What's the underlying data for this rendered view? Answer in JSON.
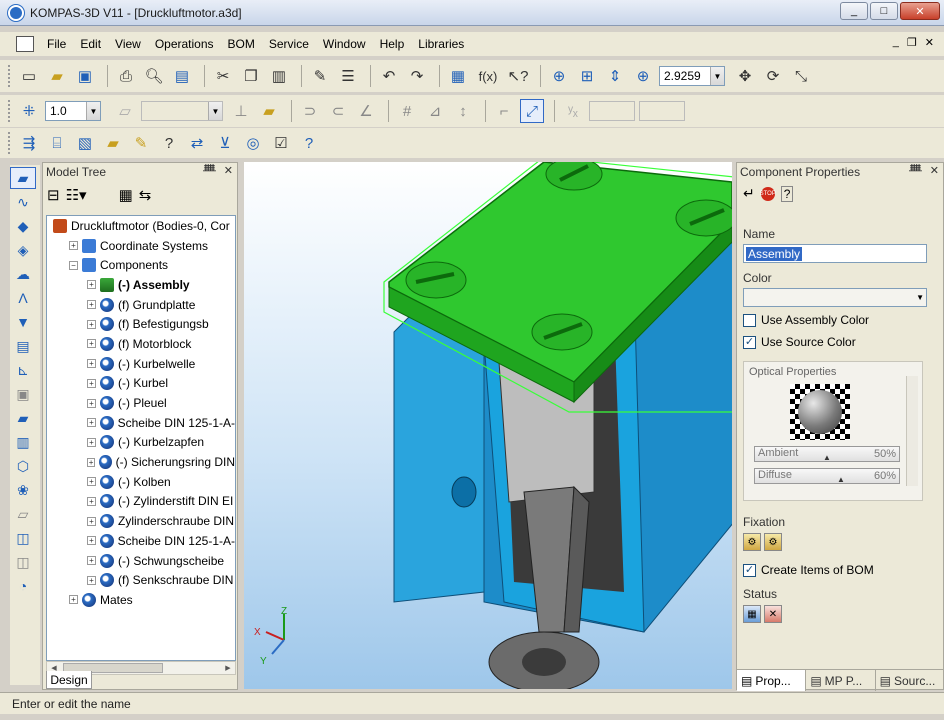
{
  "window": {
    "title": "KOMPAS-3D V11 - [Druckluftmotor.a3d]",
    "min": "_",
    "max": "□",
    "close": "✕"
  },
  "menu": {
    "items": [
      "File",
      "Edit",
      "View",
      "Operations",
      "BOM",
      "Service",
      "Window",
      "Help",
      "Libraries"
    ],
    "doc_min": "_",
    "doc_restore": "❐",
    "doc_close": "✕"
  },
  "toolbar": {
    "zoom_value": "2.9259",
    "line_scale": "1.0",
    "icons_row1": [
      "new-file-icon",
      "open-folder-icon",
      "save-icon",
      "print-icon",
      "preview-icon",
      "copy-props-icon",
      "cut-icon",
      "copy-icon",
      "paste-icon",
      "brush-icon",
      "props-icon",
      "undo-icon",
      "redo-icon",
      "manager-icon",
      "variables-icon",
      "help-pointer-icon",
      "zoom-window-icon",
      "zoom-in-icon",
      "zoom-dynamic-icon",
      "zoom-scale-icon",
      "pan-icon",
      "rotate-icon",
      "orientation-icon"
    ],
    "fx_label": "f(x)"
  },
  "model_tree": {
    "title": "Model Tree",
    "pin": "ᚙ",
    "close": "✕",
    "nodes": [
      {
        "label": "Druckluftmotor (Bodies-0, Cor",
        "level": 0,
        "exp": "",
        "icon": "root"
      },
      {
        "label": "Coordinate Systems",
        "level": 1,
        "exp": "+",
        "icon": "bluebox"
      },
      {
        "label": "Components",
        "level": 1,
        "exp": "−",
        "icon": "bluebox"
      },
      {
        "label": "(-) Assembly",
        "level": 2,
        "exp": "+",
        "icon": "asm",
        "bold": true
      },
      {
        "label": "(f) Grundplatte",
        "level": 2,
        "exp": "+",
        "icon": "part"
      },
      {
        "label": "(f) Befestigungsb",
        "level": 2,
        "exp": "+",
        "icon": "part"
      },
      {
        "label": "(f) Motorblock",
        "level": 2,
        "exp": "+",
        "icon": "part"
      },
      {
        "label": "(-) Kurbelwelle",
        "level": 2,
        "exp": "+",
        "icon": "part"
      },
      {
        "label": "(-) Kurbel",
        "level": 2,
        "exp": "+",
        "icon": "part"
      },
      {
        "label": "(-) Pleuel",
        "level": 2,
        "exp": "+",
        "icon": "part"
      },
      {
        "label": "Scheibe DIN 125-1-A-",
        "level": 2,
        "exp": "+",
        "icon": "part"
      },
      {
        "label": "(-) Kurbelzapfen",
        "level": 2,
        "exp": "+",
        "icon": "part"
      },
      {
        "label": "(-) Sicherungsring DIN",
        "level": 2,
        "exp": "+",
        "icon": "part"
      },
      {
        "label": "(-) Kolben",
        "level": 2,
        "exp": "+",
        "icon": "part"
      },
      {
        "label": "(-) Zylinderstift DIN EI",
        "level": 2,
        "exp": "+",
        "icon": "part"
      },
      {
        "label": "Zylinderschraube DIN",
        "level": 2,
        "exp": "+",
        "icon": "part"
      },
      {
        "label": "Scheibe DIN 125-1-A-",
        "level": 2,
        "exp": "+",
        "icon": "part"
      },
      {
        "label": "(-) Schwungscheibe",
        "level": 2,
        "exp": "+",
        "icon": "part"
      },
      {
        "label": "(f) Senkschraube DIN",
        "level": 2,
        "exp": "+",
        "icon": "part"
      },
      {
        "label": "Mates",
        "level": 1,
        "exp": "+",
        "icon": "mates"
      }
    ],
    "design_tab": "Design"
  },
  "viewport": {
    "axis_x": "X",
    "axis_y": "Y",
    "axis_z": "Z",
    "colors": {
      "top_plate": "#2fc82f",
      "block": "#2aa4dd",
      "rod": "#8a8a8a"
    }
  },
  "properties": {
    "title": "Component Properties",
    "name_label": "Name",
    "name_value": "Assembly",
    "color_label": "Color",
    "use_assembly_color": "Use Assembly Color",
    "use_source_color": "Use Source Color",
    "use_assembly_color_checked": false,
    "use_source_color_checked": true,
    "optical_label": "Optical Properties",
    "ambient_label": "Ambient",
    "ambient_value": "50%",
    "diffuse_label": "Diffuse",
    "diffuse_value": "60%",
    "fixation_label": "Fixation",
    "create_items": "Create Items of BOM",
    "create_items_checked": true,
    "status_label": "Status",
    "tabs": [
      "Prop...",
      "MP P...",
      "Sourc..."
    ]
  },
  "status": {
    "text": "Enter or edit the name"
  }
}
